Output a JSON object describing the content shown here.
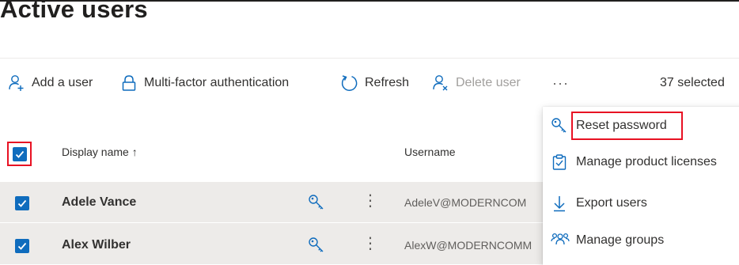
{
  "page": {
    "title": "Active users"
  },
  "toolbar": {
    "add_user": "Add a user",
    "mfa": "Multi-factor authentication",
    "refresh": "Refresh",
    "delete_user": "Delete user",
    "more": "···",
    "selected_count": "37 selected"
  },
  "table": {
    "columns": {
      "display_name": "Display name ↑",
      "username": "Username"
    },
    "rows": [
      {
        "display_name": "Adele Vance",
        "username": "AdeleV@MODERNCOM",
        "selected": true
      },
      {
        "display_name": "Alex Wilber",
        "username": "AlexW@MODERNCOMM",
        "selected": true
      }
    ]
  },
  "context_menu": {
    "items": [
      {
        "label": "Reset password",
        "icon": "key-icon"
      },
      {
        "label": "Manage product licenses",
        "icon": "clipboard-icon"
      },
      {
        "label": "Export users",
        "icon": "download-arrow-icon"
      },
      {
        "label": "Manage groups",
        "icon": "people-group-icon"
      }
    ]
  },
  "colors": {
    "accent": "#0f6cbd",
    "highlight_box": "#e81123",
    "row_selected": "#edebe9",
    "disabled_text": "#a19f9d"
  }
}
